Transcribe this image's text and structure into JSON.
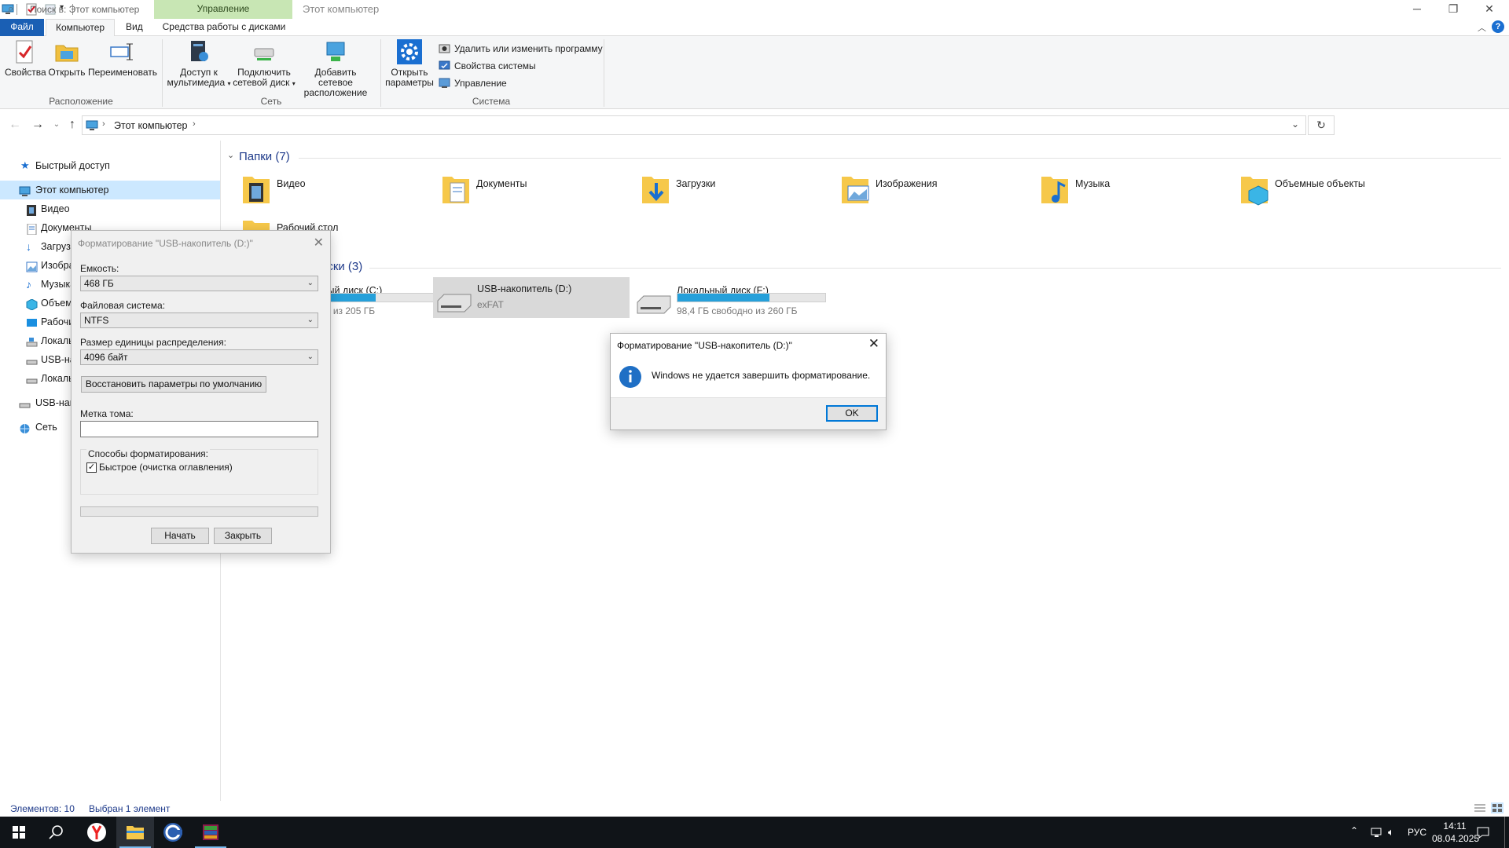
{
  "window": {
    "title": "Этот компьютер",
    "context_tab": "Управление",
    "min": "─",
    "max": "❐",
    "close": "✕"
  },
  "ribbon": {
    "tabs": [
      "Файл",
      "Компьютер",
      "Вид",
      "Средства работы с дисками"
    ],
    "groups": {
      "location": {
        "label": "Расположение",
        "buttons": [
          "Свойства",
          "Открыть",
          "Переименовать"
        ]
      },
      "network": {
        "label": "Сеть",
        "media_1": "Доступ к",
        "media_2": "мультимедиа",
        "map_1": "Подключить",
        "map_2": "сетевой диск",
        "add_1": "Добавить сетевое",
        "add_2": "расположение"
      },
      "system": {
        "label": "Система",
        "open_1": "Открыть",
        "open_2": "параметры",
        "items": [
          "Удалить или изменить программу",
          "Свойства системы",
          "Управление"
        ]
      }
    }
  },
  "address": {
    "path": "Этот компьютер",
    "search_placeholder": "Поиск в: Этот компьютер"
  },
  "sidebar": {
    "items": [
      "Быстрый доступ",
      "Этот компьютер",
      "Видео",
      "Документы",
      "Загрузки",
      "Изображения",
      "Музыка",
      "Объемные объекты",
      "Рабочий стол",
      "Локальный диск (C:)",
      "USB-накопитель (D:)",
      "Локальный диск (F:)",
      "USB-накопитель (D:)",
      "Сеть"
    ]
  },
  "content": {
    "folders_header": "Папки (7)",
    "folders": [
      "Видео",
      "Документы",
      "Загрузки",
      "Изображения",
      "Музыка",
      "Объемные объекты",
      "Рабочий стол"
    ],
    "drives_header": "Устройства и диски (3)",
    "drives": [
      {
        "name": "Локальный диск (C:)",
        "sub": "свободно из 205 ГБ",
        "used_fraction": 0.58
      },
      {
        "name": "USB-накопитель (D:)",
        "sub": "exFAT"
      },
      {
        "name": "Локальный диск (F:)",
        "sub": "98,4 ГБ свободно из 260 ГБ",
        "used_fraction": 0.62
      }
    ]
  },
  "status": {
    "count": "Элементов: 10",
    "selected": "Выбран 1 элемент"
  },
  "format_dialog": {
    "title": "Форматирование \"USB-накопитель (D:)\"",
    "capacity_label": "Емкость:",
    "capacity_value": "468 ГБ",
    "fs_label": "Файловая система:",
    "fs_value": "NTFS",
    "alloc_label": "Размер единицы распределения:",
    "alloc_value": "4096 байт",
    "restore_button": "Восстановить параметры по умолчанию",
    "volume_label": "Метка тома:",
    "volume_value": "",
    "options_label": "Способы форматирования:",
    "quick_label": "Быстрое (очистка оглавления)",
    "start_button": "Начать",
    "close_button": "Закрыть"
  },
  "message_box": {
    "title": "Форматирование \"USB-накопитель (D:)\"",
    "text": "Windows не удается завершить форматирование.",
    "ok_button": "OK"
  },
  "taskbar": {
    "lang": "РУС",
    "time": "14:11",
    "date": "08.04.2025"
  }
}
